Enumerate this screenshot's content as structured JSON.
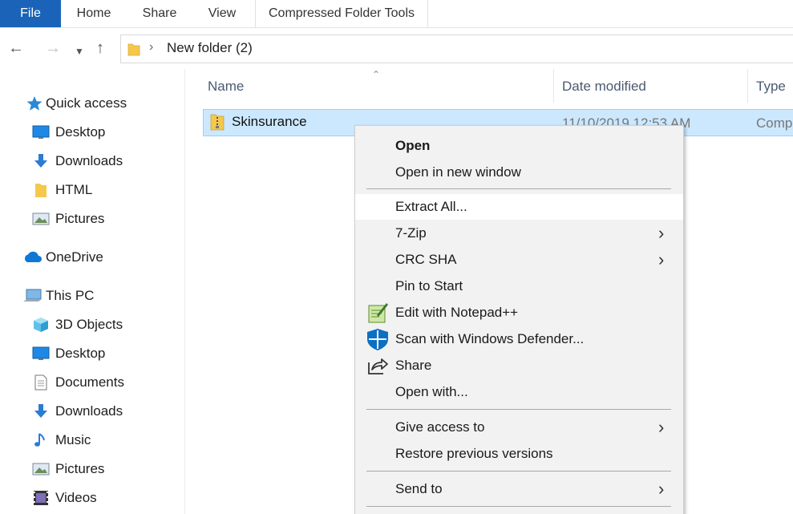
{
  "ribbon": {
    "tabs": [
      {
        "label": "File"
      },
      {
        "label": "Home"
      },
      {
        "label": "Share"
      },
      {
        "label": "View"
      },
      {
        "label": "Compressed Folder Tools"
      }
    ]
  },
  "address": {
    "path": "New folder (2)"
  },
  "nav_pane": {
    "items": [
      {
        "label": "Quick access",
        "icon": "star-icon"
      },
      {
        "label": "Desktop",
        "icon": "desktop-icon"
      },
      {
        "label": "Downloads",
        "icon": "download-icon"
      },
      {
        "label": "HTML",
        "icon": "folder-icon"
      },
      {
        "label": "Pictures",
        "icon": "pictures-icon"
      },
      {
        "label": "OneDrive",
        "icon": "cloud-icon"
      },
      {
        "label": "This PC",
        "icon": "pc-icon"
      },
      {
        "label": "3D Objects",
        "icon": "cube-icon"
      },
      {
        "label": "Desktop",
        "icon": "desktop-icon"
      },
      {
        "label": "Documents",
        "icon": "document-icon"
      },
      {
        "label": "Downloads",
        "icon": "download-icon"
      },
      {
        "label": "Music",
        "icon": "music-icon"
      },
      {
        "label": "Pictures",
        "icon": "pictures-icon"
      },
      {
        "label": "Videos",
        "icon": "video-icon"
      }
    ]
  },
  "file_list": {
    "columns": {
      "name": "Name",
      "date": "Date modified",
      "type": "Type"
    },
    "rows": [
      {
        "name": "Skinsurance",
        "date": "11/10/2019 12:53 AM",
        "type": "Comp"
      }
    ]
  },
  "context_menu": {
    "items": [
      {
        "label": "Open"
      },
      {
        "label": "Open in new window"
      },
      {
        "label": "Extract All..."
      },
      {
        "label": "7-Zip"
      },
      {
        "label": "CRC SHA"
      },
      {
        "label": "Pin to Start"
      },
      {
        "label": "Edit with Notepad++"
      },
      {
        "label": "Scan with Windows Defender..."
      },
      {
        "label": "Share"
      },
      {
        "label": "Open with..."
      },
      {
        "label": "Give access to"
      },
      {
        "label": "Restore previous versions"
      },
      {
        "label": "Send to"
      }
    ]
  },
  "colors": {
    "accent": "#1a63b8",
    "selection": "#cce8ff",
    "selection_border": "#99d1ff",
    "menu_bg": "#f2f2f2"
  }
}
